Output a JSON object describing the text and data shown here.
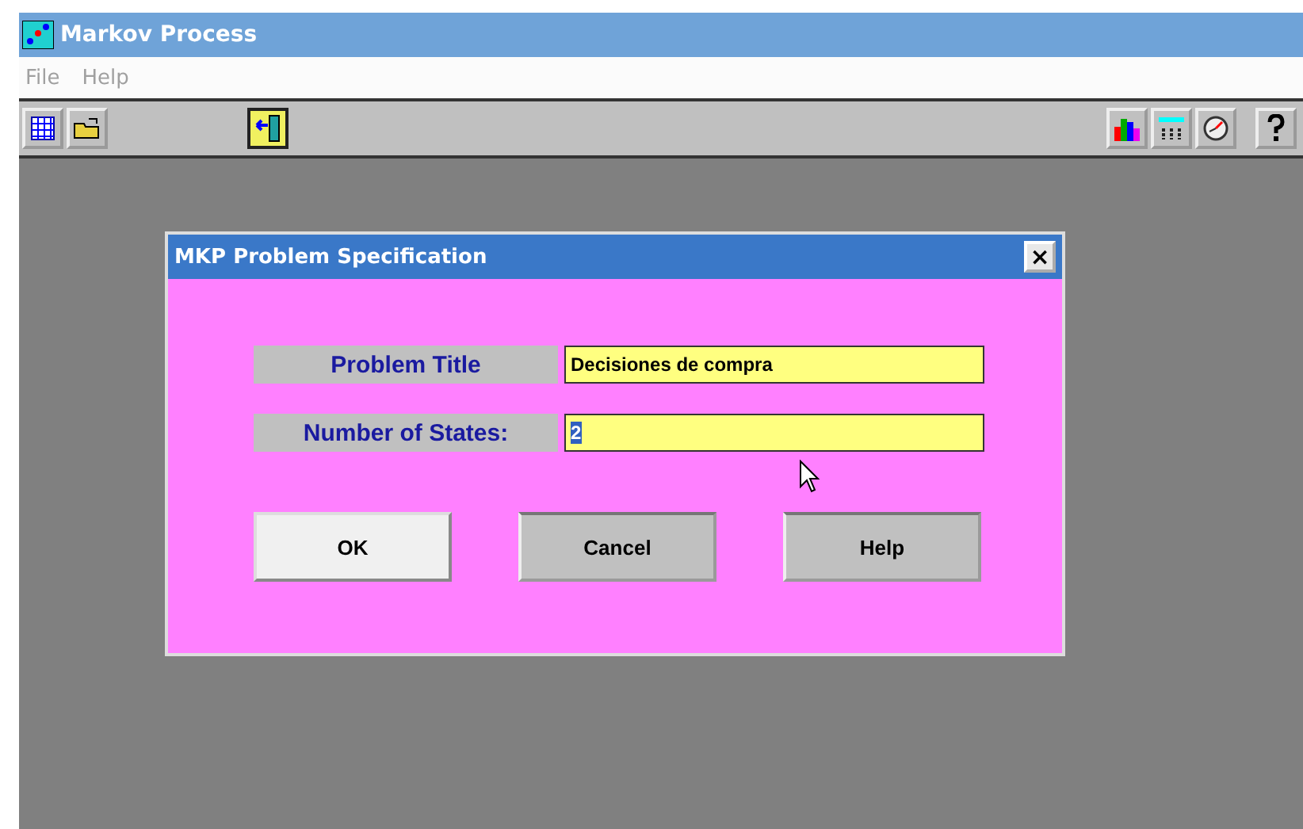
{
  "window": {
    "title": "Markov Process"
  },
  "menu": [
    "File",
    "Help"
  ],
  "toolbar_left": [
    {
      "kind": "grid"
    },
    {
      "kind": "open"
    },
    {
      "kind": "exit"
    }
  ],
  "toolbar_right": [
    {
      "kind": "chart"
    },
    {
      "kind": "calc"
    },
    {
      "kind": "clock"
    },
    {
      "kind": "help"
    }
  ],
  "dialog": {
    "title": "MKP Problem Specification",
    "close": "×",
    "fields": [
      {
        "label": "Problem Title",
        "value": "Decisiones de compra",
        "highlighted": false
      },
      {
        "label": "Number of States:",
        "value": "2",
        "highlighted": true
      }
    ],
    "buttons": [
      {
        "label": "OK",
        "default": true
      },
      {
        "label": "Cancel",
        "default": false
      },
      {
        "label": "Help",
        "default": false
      }
    ]
  }
}
